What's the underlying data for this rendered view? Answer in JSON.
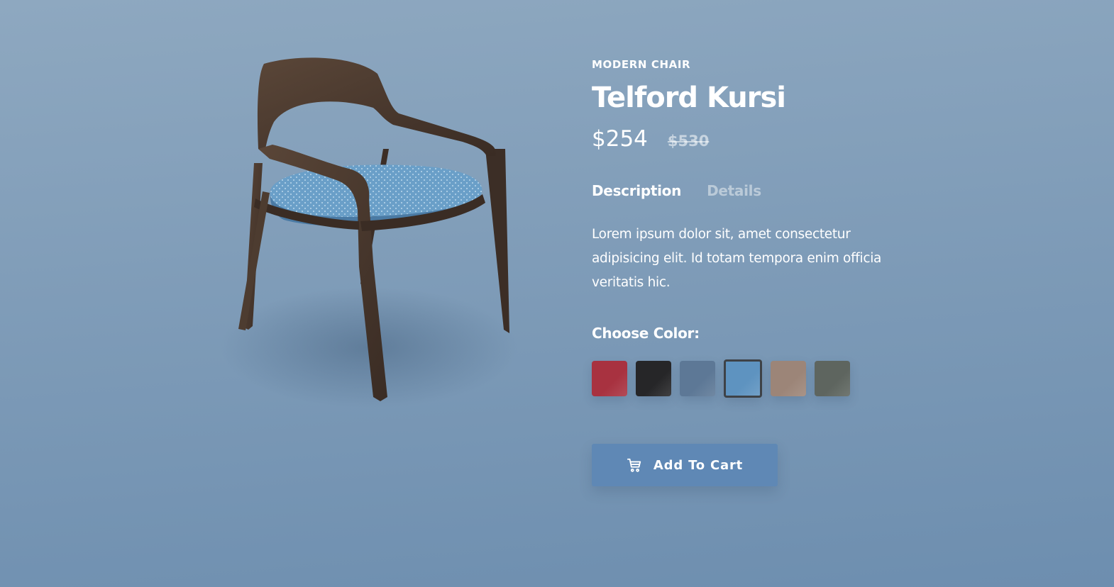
{
  "product": {
    "category": "MODERN CHAIR",
    "name": "Telford Kursi",
    "price": "$254",
    "old_price": "$530"
  },
  "tabs": [
    {
      "label": "Description",
      "active": true
    },
    {
      "label": "Details",
      "active": false
    }
  ],
  "description": "Lorem ipsum dolor sit, amet consectetur adipisicing elit. Id totam tempora enim officia veritatis hic.",
  "colors": {
    "label": "Choose Color:",
    "swatches": [
      {
        "name": "red",
        "color": "#a83240",
        "selected": false
      },
      {
        "name": "black",
        "color": "#262628",
        "selected": false
      },
      {
        "name": "denim",
        "color": "#5d7896",
        "selected": false
      },
      {
        "name": "light-blue",
        "color": "#5e93c0",
        "selected": true
      },
      {
        "name": "taupe",
        "color": "#9c8578",
        "selected": false
      },
      {
        "name": "olive-gray",
        "color": "#5e655f",
        "selected": false
      }
    ]
  },
  "cart_button": {
    "label": "Add To Cart",
    "icon": "cart-icon"
  },
  "theme": {
    "background": "#8ea8c0",
    "button": "#5f88b5",
    "wood": "#4a3a30",
    "seat": "#6a9fc8"
  }
}
